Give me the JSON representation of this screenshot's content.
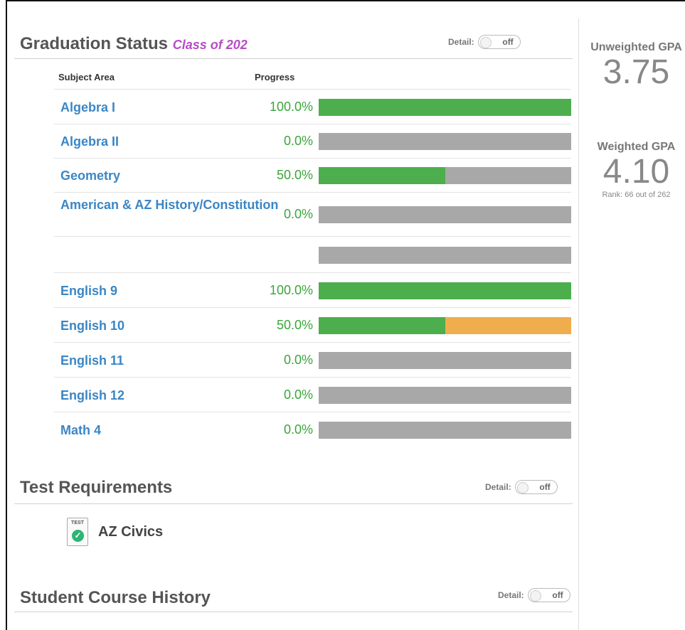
{
  "graduation": {
    "title": "Graduation Status",
    "class_of": "Class of 202",
    "detail_label": "Detail:",
    "detail_state": "off",
    "columns": {
      "subject": "Subject Area",
      "progress": "Progress"
    },
    "rows": [
      {
        "subject": "Algebra I",
        "percent_text": "100.0%",
        "complete": 1.0,
        "in_progress": 0.0
      },
      {
        "subject": "Algebra II",
        "percent_text": "0.0%",
        "complete": 0.0,
        "in_progress": 0.0
      },
      {
        "subject": "Geometry",
        "percent_text": "50.0%",
        "complete": 0.5,
        "in_progress": 0.0
      },
      {
        "subject": "American & AZ History/Constitution",
        "percent_text": "0.0%",
        "complete": 0.0,
        "in_progress": 0.0
      },
      {
        "subject": "",
        "percent_text": "",
        "complete": 0.0,
        "in_progress": 0.0
      },
      {
        "subject": "English 9",
        "percent_text": "100.0%",
        "complete": 1.0,
        "in_progress": 0.0
      },
      {
        "subject": "English 10",
        "percent_text": "50.0%",
        "complete": 0.5,
        "in_progress": 0.5
      },
      {
        "subject": "English 11",
        "percent_text": "0.0%",
        "complete": 0.0,
        "in_progress": 0.0
      },
      {
        "subject": "English 12",
        "percent_text": "0.0%",
        "complete": 0.0,
        "in_progress": 0.0
      },
      {
        "subject": "Math 4",
        "percent_text": "0.0%",
        "complete": 0.0,
        "in_progress": 0.0
      }
    ]
  },
  "gpa": {
    "unweighted_label": "Unweighted GPA",
    "unweighted_value": "3.75",
    "weighted_label": "Weighted GPA",
    "weighted_value": "4.10",
    "rank": "Rank: 66 out of 262"
  },
  "tests": {
    "title": "Test Requirements",
    "detail_label": "Detail:",
    "detail_state": "off",
    "items": [
      {
        "name": "AZ Civics",
        "icon_label": "TEST"
      }
    ]
  },
  "history": {
    "title": "Student Course History",
    "detail_label": "Detail:",
    "detail_state": "off"
  },
  "colors": {
    "link": "#3a86c6",
    "percent": "#3aa53a",
    "bar_complete": "#4cae4c",
    "bar_in_progress": "#f0ad4e",
    "bar_empty": "#a8a8a8",
    "class_of": "#b54cc6"
  }
}
